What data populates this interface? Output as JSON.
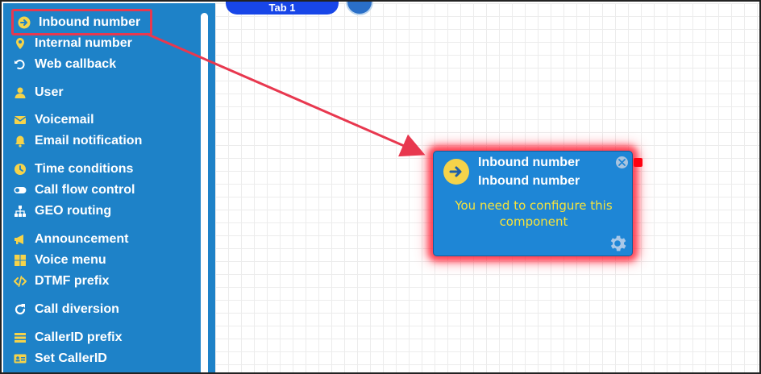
{
  "sidebar": {
    "items": [
      {
        "label": "Inbound number",
        "icon": "circle-arrow-right-icon"
      },
      {
        "label": "Internal number",
        "icon": "map-pin-icon"
      },
      {
        "label": "Web callback",
        "icon": "callback-icon"
      },
      {
        "label": "User",
        "icon": "user-icon"
      },
      {
        "label": "Voicemail",
        "icon": "envelope-icon"
      },
      {
        "label": "Email notification",
        "icon": "bell-icon"
      },
      {
        "label": "Time conditions",
        "icon": "clock-icon"
      },
      {
        "label": "Call flow control",
        "icon": "toggle-icon"
      },
      {
        "label": "GEO routing",
        "icon": "sitemap-icon"
      },
      {
        "label": "Announcement",
        "icon": "megaphone-icon"
      },
      {
        "label": "Voice menu",
        "icon": "grid-icon"
      },
      {
        "label": "DTMF prefix",
        "icon": "code-icon"
      },
      {
        "label": "Call diversion",
        "icon": "redo-icon"
      },
      {
        "label": "CallerID prefix",
        "icon": "list-icon"
      },
      {
        "label": "Set CallerID",
        "icon": "id-card-icon"
      }
    ],
    "selected_index": 0
  },
  "canvas": {
    "tab_label": "Tab 1"
  },
  "node": {
    "title": "Inbound number",
    "subtitle": "Inbound number",
    "message": "You need to configure this component",
    "icon": "arrow-right-icon"
  },
  "colors": {
    "sidebar_bg": "#1e82c8",
    "node_bg": "#1e86d6",
    "node_glow": "#ff1e32",
    "message_text": "#f6e23c",
    "highlight": "#e8384f",
    "tab_pill": "#1846e8"
  }
}
